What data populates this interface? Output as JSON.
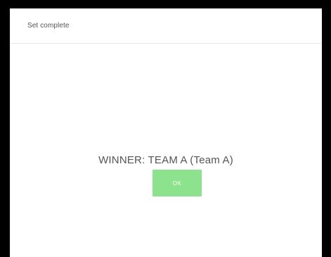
{
  "dialog": {
    "title": "Set complete",
    "message": "WINNER: TEAM A (Team A)",
    "ok_label": "OK"
  },
  "colors": {
    "frame": "#000000",
    "dialog_background": "#ffffff",
    "ok_button": "#8de38d",
    "text": "#555555"
  }
}
